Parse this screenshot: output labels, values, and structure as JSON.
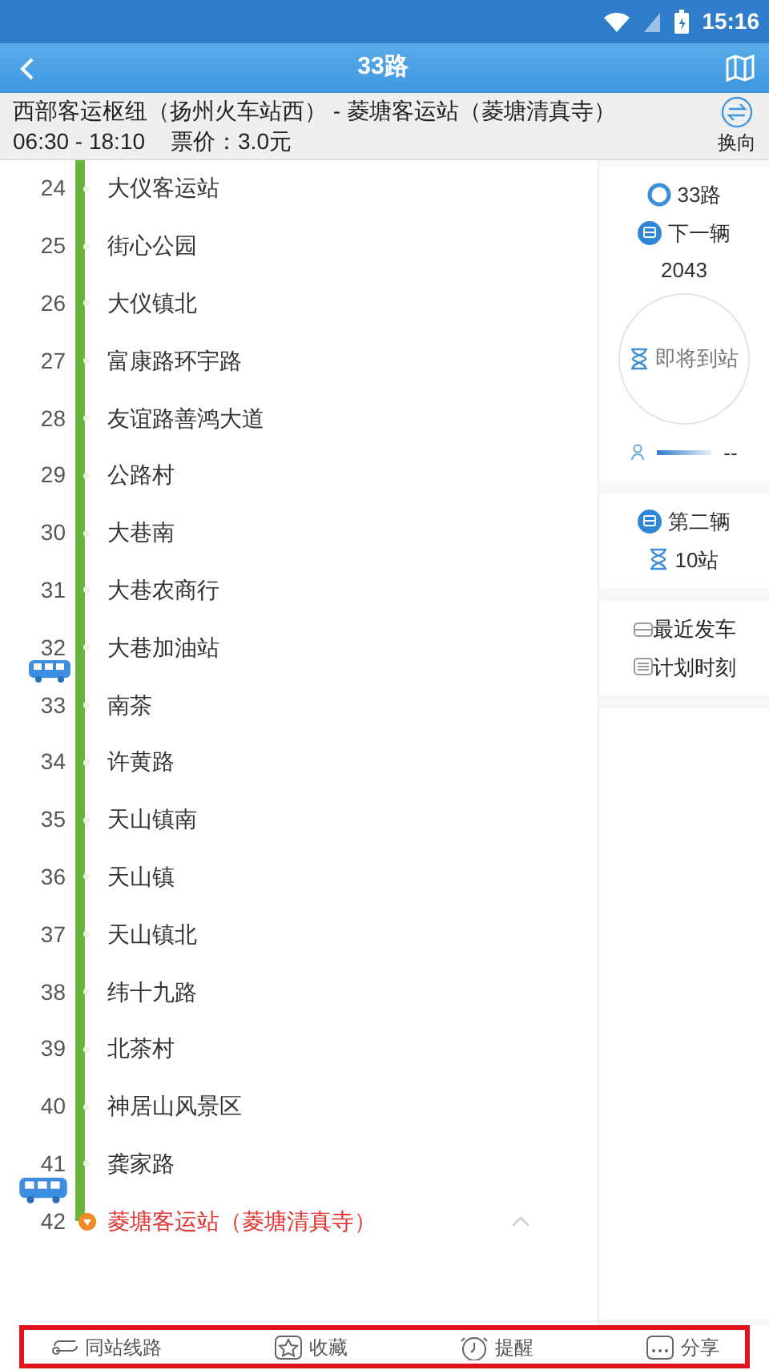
{
  "status_bar": {
    "time": "15:16"
  },
  "header": {
    "title": "33路"
  },
  "route": {
    "name": "西部客运枢纽（扬州火车站西） - 菱塘客运站（菱塘清真寺）",
    "hours": "06:30 - 18:10",
    "fare": "票价：3.0元",
    "reverse_label": "换向"
  },
  "stops": [
    {
      "number": "24",
      "name": "大仪客运站",
      "kind": "normal",
      "bus_after": false
    },
    {
      "number": "25",
      "name": "街心公园",
      "kind": "normal",
      "bus_after": false
    },
    {
      "number": "26",
      "name": "大仪镇北",
      "kind": "normal",
      "bus_after": false
    },
    {
      "number": "27",
      "name": "富康路环宇路",
      "kind": "normal",
      "bus_after": false
    },
    {
      "number": "28",
      "name": "友谊路善鸿大道",
      "kind": "normal",
      "bus_after": false
    },
    {
      "number": "29",
      "name": "公路村",
      "kind": "normal",
      "bus_after": false
    },
    {
      "number": "30",
      "name": "大巷南",
      "kind": "normal",
      "bus_after": false
    },
    {
      "number": "31",
      "name": "大巷农商行",
      "kind": "normal",
      "bus_after": false
    },
    {
      "number": "32",
      "name": "大巷加油站",
      "kind": "normal",
      "bus_after": true
    },
    {
      "number": "33",
      "name": "南茶",
      "kind": "normal",
      "bus_after": false
    },
    {
      "number": "34",
      "name": "许黄路",
      "kind": "normal",
      "bus_after": false
    },
    {
      "number": "35",
      "name": "天山镇南",
      "kind": "normal",
      "bus_after": false
    },
    {
      "number": "36",
      "name": "天山镇",
      "kind": "normal",
      "bus_after": false
    },
    {
      "number": "37",
      "name": "天山镇北",
      "kind": "normal",
      "bus_after": false
    },
    {
      "number": "38",
      "name": "纬十九路",
      "kind": "normal",
      "bus_after": false
    },
    {
      "number": "39",
      "name": "北茶村",
      "kind": "normal",
      "bus_after": false
    },
    {
      "number": "40",
      "name": "神居山风景区",
      "kind": "normal",
      "bus_after": false
    },
    {
      "number": "41",
      "name": "龚家路",
      "kind": "normal",
      "bus_after": true
    },
    {
      "number": "42",
      "name": "菱塘客运站（菱塘清真寺）",
      "kind": "terminal",
      "bus_after": false
    }
  ],
  "side_panel": {
    "route_label": "33路",
    "next_label": "下一辆",
    "next_plate": "2043",
    "next_status": "即将到站",
    "crowd": "--",
    "second_label": "第二辆",
    "second_distance": "10站",
    "links": [
      {
        "label": "最近发车",
        "kind": "recent"
      },
      {
        "label": "计划时刻",
        "kind": "schedule"
      }
    ]
  },
  "bottom_bar": [
    {
      "label": "同站线路",
      "kind": "transfer"
    },
    {
      "label": "收藏",
      "kind": "favorite"
    },
    {
      "label": "提醒",
      "kind": "alarm"
    },
    {
      "label": "分享",
      "kind": "share"
    }
  ]
}
